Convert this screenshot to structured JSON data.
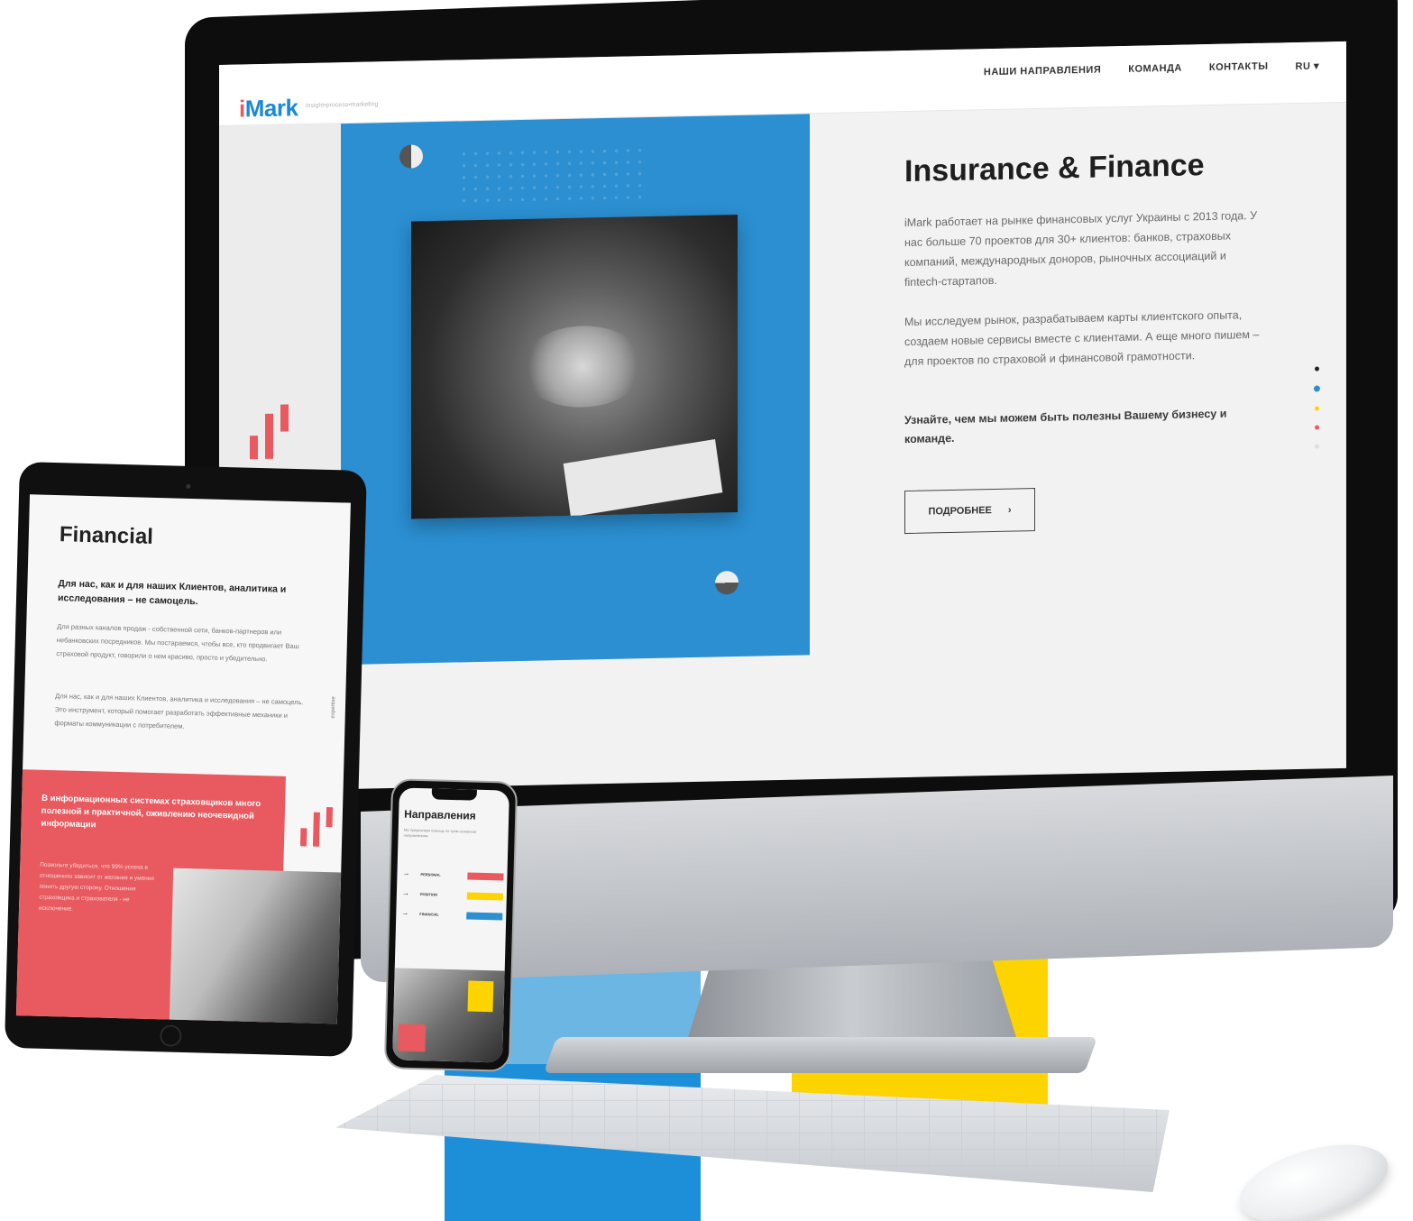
{
  "brand": {
    "logo": "iMark",
    "tagline": "insight•process•marketing"
  },
  "desktop": {
    "nav": [
      "НАШИ НАПРАВЛЕНИЯ",
      "КОМАНДА",
      "КОНТАКТЫ",
      "RU ▾"
    ],
    "hero": {
      "title": "Insurance & Finance",
      "p1": "iMark работает на рынке финансовых услуг Украины с 2013 года. У нас больше 70 проектов для 30+ клиентов: банков, страховых компаний, международных доноров, рыночных ассоциаций и fintech-стартапов.",
      "p2": "Мы исследуем рынок, разрабатываем карты клиентского опыта, создаем новые сервисы вместе с клиентами. А еще много пишем – для проектов по страховой и финансовой грамотности.",
      "strong": "Узнайте, чем мы можем быть полезны Вашему бизнесу и команде.",
      "button": "ПОДРОБНЕЕ",
      "button_icon": "chevron-right-icon"
    },
    "pager_colors": [
      "#222222",
      "#2b8fd1",
      "#FDD400",
      "#E85A5F",
      "#dddddd"
    ]
  },
  "tablet": {
    "title": "Financial",
    "strong": "Для нас, как и для наших Клиентов, аналитика и исследования – не самоцель.",
    "p1": "Для разных каналов продаж - собственной сети, банков-партнеров или небанковских посредников. Мы постараемся, чтобы все, кто продвигает Ваш страховой продукт, говорили о нем красиво, просто и убедительно.",
    "p2": "Для нас, как и для наших Клиентов, аналитика и исследования – не самоцель. Это инструмент, который помогает разработать эффективные механики и форматы коммуникации с потребителем.",
    "side_label": "expertise",
    "red_title": "В информационных системах страховщиков много полезной и практичной, оживлению неочевидной информации",
    "red_p": "Позвольте убедиться, что 99% успеха в отношениях зависит от желания и умения понять другую сторону. Отношения страховщика и страхователя - не исключение."
  },
  "phone": {
    "title": "Направления",
    "subtitle": "Мы предлагаем помощь по трем основным направлениям",
    "rows": [
      {
        "label": "PERSONAL",
        "color": "#E85A5F"
      },
      {
        "label": "POSITION",
        "color": "#FDD400"
      },
      {
        "label": "FINANCIAL",
        "color": "#2b8fd1"
      }
    ]
  },
  "colors": {
    "blue": "#2b8fd1",
    "red": "#E85A5F",
    "yellow": "#FDD400"
  }
}
